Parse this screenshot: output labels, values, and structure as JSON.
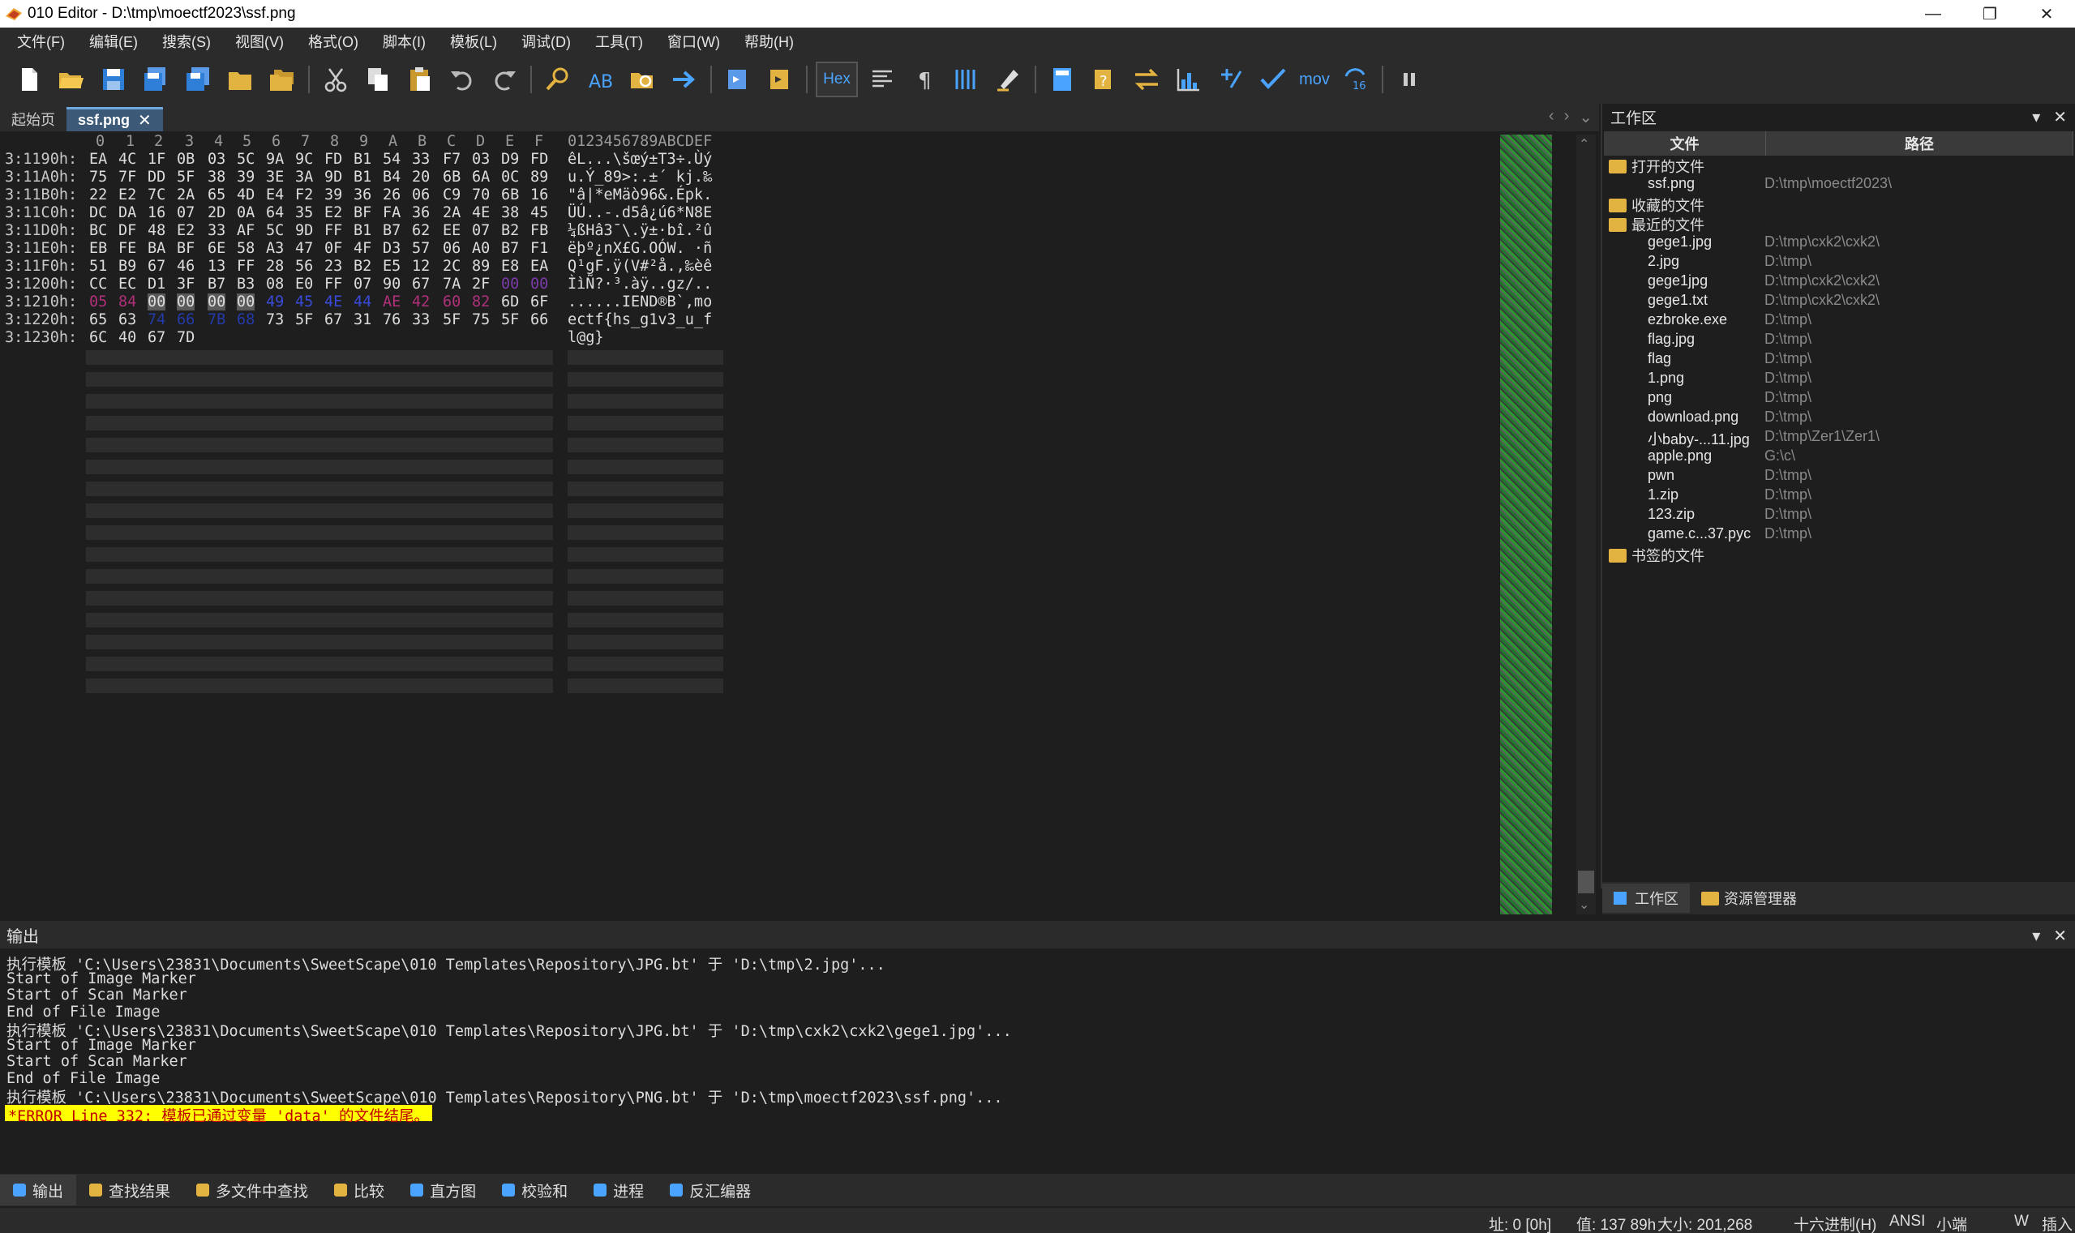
{
  "window": {
    "title": "010 Editor - D:\\tmp\\moectf2023\\ssf.png",
    "controls": [
      "—",
      "❐",
      "✕"
    ]
  },
  "menu": [
    "文件(F)",
    "编辑(E)",
    "搜索(S)",
    "视图(V)",
    "格式(O)",
    "脚本(I)",
    "模板(L)",
    "调试(D)",
    "工具(T)",
    "窗口(W)",
    "帮助(H)"
  ],
  "toolbar": {
    "hex_label": "Hex",
    "mov_label": "mov",
    "base_label": "10/16"
  },
  "tabs": {
    "start": "起始页",
    "file": "ssf.png",
    "close": "✕"
  },
  "hex": {
    "column_headers": [
      "0",
      "1",
      "2",
      "3",
      "4",
      "5",
      "6",
      "7",
      "8",
      "9",
      "A",
      "B",
      "C",
      "D",
      "E",
      "F"
    ],
    "ascii_header": "0123456789ABCDEF",
    "rows": [
      {
        "addr": "3:1190h:",
        "bytes": [
          "EA",
          "4C",
          "1F",
          "0B",
          "03",
          "5C",
          "9A",
          "9C",
          "FD",
          "B1",
          "54",
          "33",
          "F7",
          "03",
          "D9",
          "FD"
        ],
        "ascii": "êL...\\šœý±T3÷.Ùý"
      },
      {
        "addr": "3:11A0h:",
        "bytes": [
          "75",
          "7F",
          "DD",
          "5F",
          "38",
          "39",
          "3E",
          "3A",
          "9D",
          "B1",
          "B4",
          "20",
          "6B",
          "6A",
          "0C",
          "89"
        ],
        "ascii": "u.Ý_89>:.±´ kj.‰"
      },
      {
        "addr": "3:11B0h:",
        "bytes": [
          "22",
          "E2",
          "7C",
          "2A",
          "65",
          "4D",
          "E4",
          "F2",
          "39",
          "36",
          "26",
          "06",
          "C9",
          "70",
          "6B",
          "16"
        ],
        "ascii": "\"â|*eMäò96&.Épk."
      },
      {
        "addr": "3:11C0h:",
        "bytes": [
          "DC",
          "DA",
          "16",
          "07",
          "2D",
          "0A",
          "64",
          "35",
          "E2",
          "BF",
          "FA",
          "36",
          "2A",
          "4E",
          "38",
          "45"
        ],
        "ascii": "ÜÚ..-.d5â¿ú6*N8E"
      },
      {
        "addr": "3:11D0h:",
        "bytes": [
          "BC",
          "DF",
          "48",
          "E2",
          "33",
          "AF",
          "5C",
          "9D",
          "FF",
          "B1",
          "B7",
          "62",
          "EE",
          "07",
          "B2",
          "FB"
        ],
        "ascii": "¼ßHâ3¯\\.ÿ±·bî.²û"
      },
      {
        "addr": "3:11E0h:",
        "bytes": [
          "EB",
          "FE",
          "BA",
          "BF",
          "6E",
          "58",
          "A3",
          "47",
          "0F",
          "4F",
          "D3",
          "57",
          "06",
          "A0",
          "B7",
          "F1"
        ],
        "ascii": "ëþº¿nX£G.OÓW. ·ñ"
      },
      {
        "addr": "3:11F0h:",
        "bytes": [
          "51",
          "B9",
          "67",
          "46",
          "13",
          "FF",
          "28",
          "56",
          "23",
          "B2",
          "E5",
          "12",
          "2C",
          "89",
          "E8",
          "EA"
        ],
        "ascii": "Q¹gF.ÿ(V#²å.,‰èê"
      },
      {
        "addr": "3:1200h:",
        "bytes": [
          "CC",
          "EC",
          "D1",
          "3F",
          "B7",
          "B3",
          "08",
          "E0",
          "FF",
          "07",
          "90",
          "67",
          "7A",
          "2F",
          "00",
          "00"
        ],
        "ascii": "ÌìÑ?·³.àÿ..gz/.."
      },
      {
        "addr": "3:1210h:",
        "bytes": [
          "05",
          "84",
          "00",
          "00",
          "00",
          "00",
          "49",
          "45",
          "4E",
          "44",
          "AE",
          "42",
          "60",
          "82",
          "6D",
          "6F"
        ],
        "ascii": "......IEND®B`‚mo"
      },
      {
        "addr": "3:1220h:",
        "bytes": [
          "65",
          "63",
          "74",
          "66",
          "7B",
          "68",
          "73",
          "5F",
          "67",
          "31",
          "76",
          "33",
          "5F",
          "75",
          "5F",
          "66"
        ],
        "ascii": "ectf{hs_g1v3_u_f"
      },
      {
        "addr": "3:1230h:",
        "bytes": [
          "6C",
          "40",
          "67",
          "7D"
        ],
        "ascii": "l@g}"
      }
    ]
  },
  "workspace": {
    "title": "工作区",
    "col_file": "文件",
    "col_path": "路径",
    "groups": {
      "open": "打开的文件",
      "favorites": "收藏的文件",
      "recent": "最近的文件",
      "bookmarks": "书签的文件"
    },
    "open_files": [
      {
        "name": "ssf.png",
        "path": "D:\\tmp\\moectf2023\\"
      }
    ],
    "recent_files": [
      {
        "name": "gege1.jpg",
        "path": "D:\\tmp\\cxk2\\cxk2\\"
      },
      {
        "name": "2.jpg",
        "path": "D:\\tmp\\"
      },
      {
        "name": "gege1jpg",
        "path": "D:\\tmp\\cxk2\\cxk2\\"
      },
      {
        "name": "gege1.txt",
        "path": "D:\\tmp\\cxk2\\cxk2\\"
      },
      {
        "name": "ezbroke.exe",
        "path": "D:\\tmp\\"
      },
      {
        "name": "flag.jpg",
        "path": "D:\\tmp\\"
      },
      {
        "name": "flag",
        "path": "D:\\tmp\\"
      },
      {
        "name": "1.png",
        "path": "D:\\tmp\\"
      },
      {
        "name": "png",
        "path": "D:\\tmp\\"
      },
      {
        "name": "download.png",
        "path": "D:\\tmp\\"
      },
      {
        "name": "小baby-...11.jpg",
        "path": "D:\\tmp\\Zer1\\Zer1\\"
      },
      {
        "name": "apple.png",
        "path": "G:\\c\\"
      },
      {
        "name": "pwn",
        "path": "D:\\tmp\\"
      },
      {
        "name": "1.zip",
        "path": "D:\\tmp\\"
      },
      {
        "name": "123.zip",
        "path": "D:\\tmp\\"
      },
      {
        "name": "game.c...37.pyc",
        "path": "D:\\tmp\\"
      }
    ],
    "tabs": [
      "工作区",
      "资源管理器"
    ]
  },
  "output": {
    "title": "输出",
    "lines": [
      "执行模板 'C:\\Users\\23831\\Documents\\SweetScape\\010 Templates\\Repository\\JPG.bt' 于 'D:\\tmp\\2.jpg'...",
      "Start of Image Marker",
      "Start of Scan Marker",
      "End of File Image",
      "执行模板 'C:\\Users\\23831\\Documents\\SweetScape\\010 Templates\\Repository\\JPG.bt' 于 'D:\\tmp\\cxk2\\cxk2\\gege1.jpg'...",
      "Start of Image Marker",
      "Start of Scan Marker",
      "End of File Image",
      "执行模板 'C:\\Users\\23831\\Documents\\SweetScape\\010 Templates\\Repository\\PNG.bt' 于 'D:\\tmp\\moectf2023\\ssf.png'..."
    ],
    "error": "*ERROR Line 332: 模板已通过变量 'data' 的文件结尾。"
  },
  "bottom_tabs": [
    "输出",
    "查找结果",
    "多文件中查找",
    "比较",
    "直方图",
    "校验和",
    "进程",
    "反汇编器"
  ],
  "status": {
    "address": "址: 0 [0h]",
    "value": "值: 137 89h",
    "size": "大小: 201,268",
    "mode": "十六进制(H)",
    "encoding": "ANSI",
    "endian": "小端",
    "w": "W",
    "insert": "插入"
  },
  "colors": {
    "accent": "#3c5a78",
    "error_bg": "#ffff00",
    "folder": "#e3b341"
  }
}
